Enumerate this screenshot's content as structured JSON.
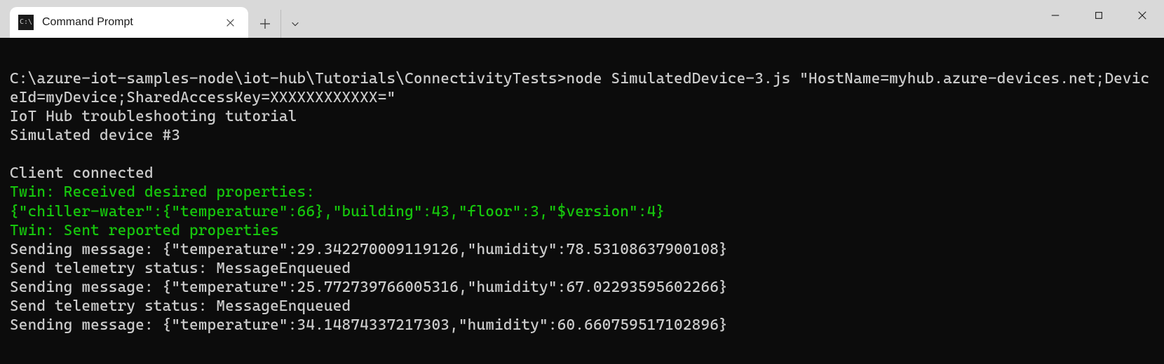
{
  "window": {
    "tab_title": "Command Prompt"
  },
  "terminal": {
    "line_cmd": "C:\\azure-iot-samples-node\\iot-hub\\Tutorials\\ConnectivityTests>node SimulatedDevice-3.js \"HostName=myhub.azure-devices.net;DeviceId=myDevice;SharedAccessKey=XXXXXXXXXXXX=\"",
    "line_tutorial": "IoT Hub troubleshooting tutorial",
    "line_sim": "Simulated device #3",
    "line_connected": "Client connected",
    "line_twin_recv": "Twin: Received desired properties:",
    "line_twin_json": "{\"chiller-water\":{\"temperature\":66},\"building\":43,\"floor\":3,\"$version\":4}",
    "line_twin_sent": "Twin: Sent reported properties",
    "line_send1": "Sending message: {\"temperature\":29.342270009119126,\"humidity\":78.53108637900108}",
    "line_status1": "Send telemetry status: MessageEnqueued",
    "line_send2": "Sending message: {\"temperature\":25.772739766005316,\"humidity\":67.02293595602266}",
    "line_status2": "Send telemetry status: MessageEnqueued",
    "line_send3": "Sending message: {\"temperature\":34.14874337217303,\"humidity\":60.660759517102896}"
  }
}
